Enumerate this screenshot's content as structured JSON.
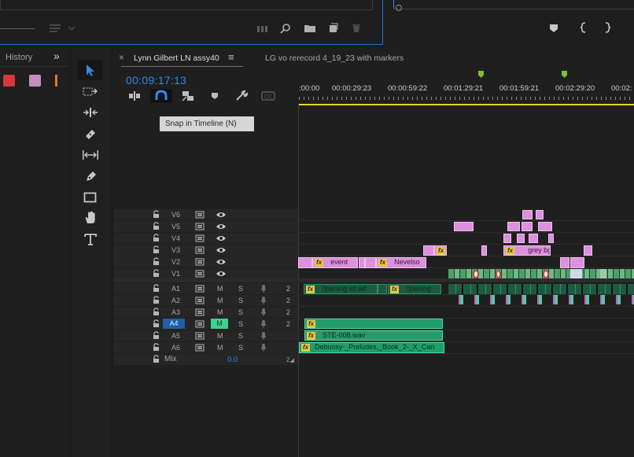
{
  "history_panel": {
    "tab_label": "History",
    "more_glyph": "»"
  },
  "source_monitor": {
    "controls": [
      "marker-icon",
      "mark-in-icon",
      "mark-out-icon"
    ]
  },
  "timeline": {
    "tabs": [
      {
        "label": "Lynn Gilbert LN assy40",
        "active": true
      },
      {
        "label": "LG vo rerecord 4_19_23 with markers",
        "active": false
      }
    ],
    "menu_glyph": "≡",
    "close_glyph": "×",
    "timecode": "00:09:17:13",
    "tooltip": "Snap in Timeline (N)",
    "ruler_labels": [
      ":00:00",
      "00:00:29:23",
      "00:00:59:22",
      "00:01:29:21",
      "00:01:59:21",
      "00:02:29:20",
      "00:02:"
    ],
    "video_tracks": [
      "V6",
      "V5",
      "V4",
      "V3",
      "V2",
      "V1"
    ],
    "audio_tracks": [
      {
        "name": "A1",
        "m": "M",
        "s": "S",
        "ch": "2",
        "active": false
      },
      {
        "name": "A2",
        "m": "M",
        "s": "S",
        "ch": "2",
        "active": false
      },
      {
        "name": "A3",
        "m": "M",
        "s": "S",
        "ch": "2",
        "active": false
      },
      {
        "name": "A4",
        "m": "M",
        "s": "S",
        "ch": "2",
        "active": true
      },
      {
        "name": "A5",
        "m": "M",
        "s": "S",
        "ch": "",
        "active": false
      },
      {
        "name": "A6",
        "m": "M",
        "s": "S",
        "ch": "",
        "active": false
      }
    ],
    "mix": {
      "label": "Mix",
      "value": "0.0"
    },
    "clips": {
      "fx": "fx",
      "event": "event",
      "nevelso": "Nevelso",
      "grey_bg": "grey bg",
      "opening_vo": "0pening vo.aif",
      "opening": "0pening",
      "ste008": "STE-008.wav",
      "debussy": "Debussy-_Preludes,_Book_2-_X_Can"
    }
  },
  "colors": {
    "accent": "#2d8ceb",
    "pink_clip": "#dd90dd",
    "green_clip": "#1f9e6b",
    "label_red": "#d8373b",
    "label_mauve": "#c38fc2",
    "label_orange": "#e0762a",
    "playhead_yellow": "#e9d33a"
  }
}
